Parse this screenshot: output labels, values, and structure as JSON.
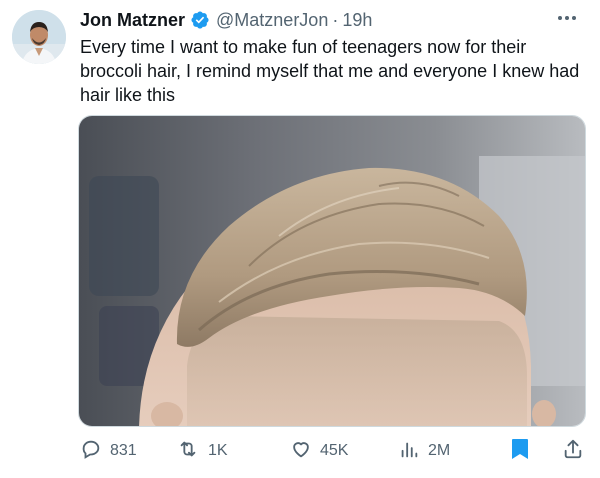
{
  "tweet": {
    "author_name": "Jon Matzner",
    "handle": "@MatznerJon",
    "separator": "·",
    "time": "19h",
    "text": "Every time I want to make fun of teenagers now for their broccoli hair, I remind myself that me and everyone I knew had hair like this",
    "verified": true
  },
  "actions": {
    "replies": "831",
    "retweets": "1K",
    "likes": "45K",
    "views": "2M"
  },
  "icons": {
    "verified": "verified-badge-icon",
    "more": "more-icon",
    "reply": "reply-icon",
    "retweet": "retweet-icon",
    "like": "heart-icon",
    "views": "views-icon",
    "bookmark": "bookmark-icon",
    "share": "share-icon"
  },
  "colors": {
    "accent": "#1d9bf0",
    "text_primary": "#0f1419",
    "text_secondary": "#536471"
  }
}
